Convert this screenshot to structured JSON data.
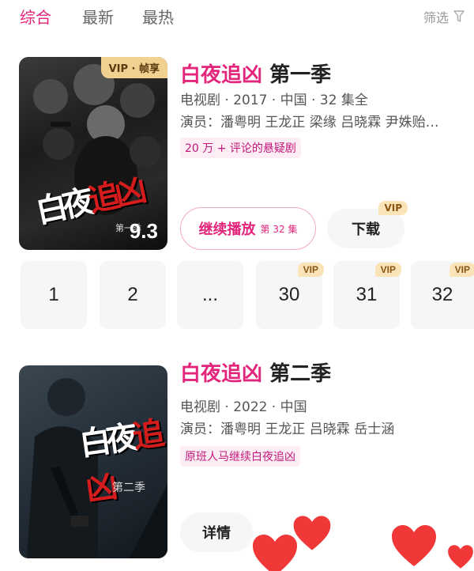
{
  "tabs": [
    {
      "label": "综合",
      "active": true
    },
    {
      "label": "最新",
      "active": false
    },
    {
      "label": "最热",
      "active": false
    }
  ],
  "filter": {
    "label": "筛选"
  },
  "results": [
    {
      "badge": "VIP · 帧享",
      "poster_title_a": "白夜",
      "poster_title_b": "追凶",
      "poster_sub": "第一季",
      "rating": "9.3",
      "title_hl": "白夜追凶",
      "title_rest": " 第一季",
      "meta": "电视剧 · 2017 · 中国 · 32 集全",
      "cast": "演员：潘粤明 王龙正 梁缘 吕晓霖 尹姝贻…",
      "tag": "20 万 + 评论的悬疑剧",
      "continue_label": "继续播放",
      "continue_ep": "第 32 集",
      "download_label": "下载",
      "download_badge": "VIP"
    },
    {
      "poster_title_a": "白夜",
      "poster_title_b": "追凶",
      "poster_sub": "第二季",
      "title_hl": "白夜追凶",
      "title_rest": " 第二季",
      "meta": "电视剧 · 2022 · 中国",
      "cast": "演员：潘粤明 王龙正 吕晓霖 岳士涵",
      "tag": "原班人马继续白夜追凶",
      "detail_label": "详情"
    }
  ],
  "episodes": [
    {
      "label": "1",
      "vip": ""
    },
    {
      "label": "2",
      "vip": ""
    },
    {
      "label": "...",
      "vip": ""
    },
    {
      "label": "30",
      "vip": "VIP"
    },
    {
      "label": "31",
      "vip": "VIP"
    },
    {
      "label": "32",
      "vip": "VIP"
    }
  ],
  "colors": {
    "accent": "#e3257b",
    "vip": "#fbe3b8",
    "heart": "#ef2d2d"
  }
}
